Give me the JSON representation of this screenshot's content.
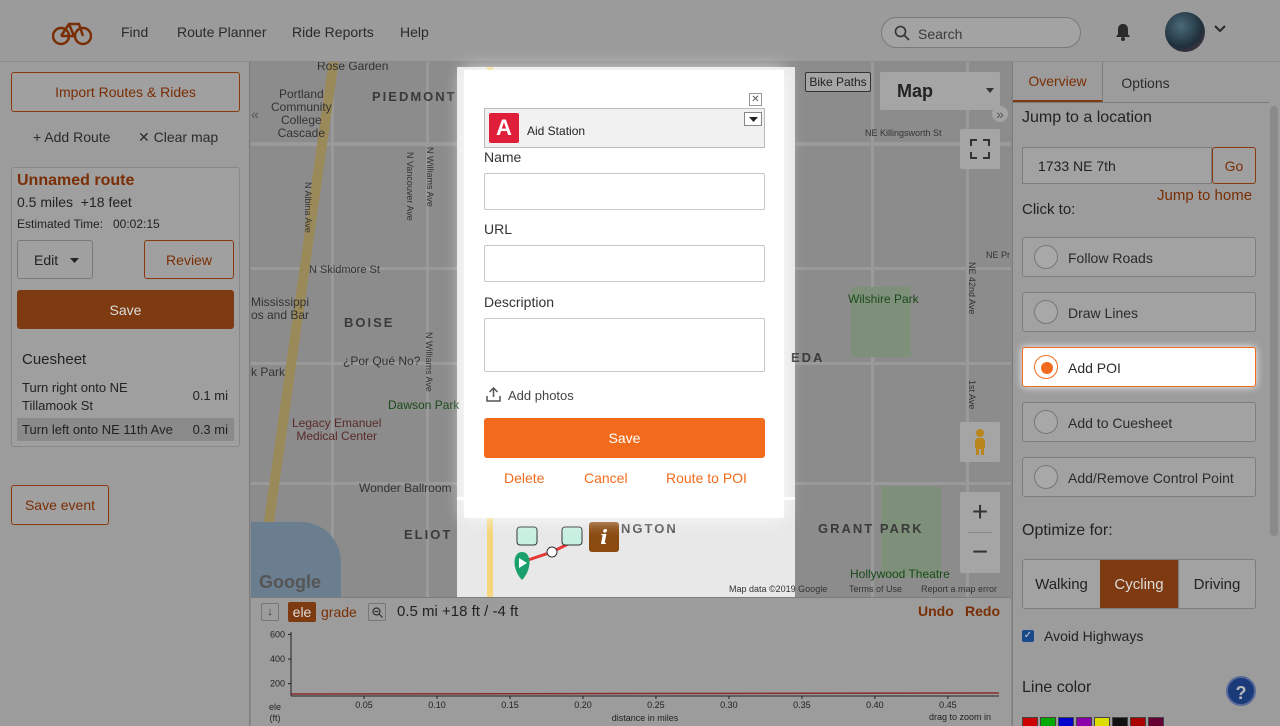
{
  "nav": {
    "find": "Find",
    "route_planner": "Route Planner",
    "ride_reports": "Ride Reports",
    "help": "Help",
    "search_placeholder": "Search"
  },
  "left": {
    "import_label": "Import Routes & Rides",
    "add_route": "+ Add Route",
    "clear_map": "✕ Clear map",
    "route_title": "Unnamed route",
    "route_stats": "0.5 miles  +18 feet",
    "estimated_label": "Estimated Time:",
    "estimated_value": "00:02:15",
    "edit_label": "Edit",
    "review_label": "Review",
    "save_label": "Save",
    "cuesheet_title": "Cuesheet",
    "cues": [
      {
        "text": "Turn right onto NE Tillamook St",
        "dist": "0.1 mi"
      },
      {
        "text": "Turn left onto NE 11th Ave",
        "dist": "0.3 mi"
      }
    ],
    "save_event": "Save event"
  },
  "map": {
    "bike_paths": "Bike Paths",
    "map_type": "Map",
    "labels": {
      "rose_garden": "Rose Garden",
      "pcc": "Portland\nCommunity\nCollege\nCascade",
      "piedmont": "PIEDMONT",
      "boise": "BOISE",
      "eliot": "ELIOT",
      "irvington": "NGTON",
      "grant_park": "GRANT PARK",
      "skidmore": "N Skidmore St",
      "mississippi": "Mississippi\nos and Bar",
      "por_que_no": "¿Por Qué No?",
      "dawson": "Dawson Park",
      "legacy": "Legacy Emanuel\nMedical Center",
      "wonder": "Wonder Ballroom",
      "wilshire": "Wilshire Park",
      "hollywood": "Hollywood Theatre",
      "killingsworth": "NE Killingsworth St",
      "k_park": "k Park",
      "eda": "EDA",
      "ne_pr": "NE Pr",
      "ne_42nd": "NE 42nd Ave",
      "n_albina": "N Albina Ave",
      "n_vancouver": "N Vancouver Ave",
      "n_williams": "N Williams Ave",
      "n_williams2": "N Williams Ave",
      "st_1": "1st Ave",
      "google": "Google",
      "map_data": "Map data ©2019 Google",
      "terms": "Terms of Use",
      "report": "Report a map error"
    }
  },
  "modal": {
    "poi_type": "Aid Station",
    "poi_letter": "A",
    "name_label": "Name",
    "url_label": "URL",
    "description_label": "Description",
    "add_photos": "Add photos",
    "save_label": "Save",
    "delete_label": "Delete",
    "cancel_label": "Cancel",
    "route_to_poi": "Route to POI"
  },
  "elevation": {
    "ele_tab": "ele",
    "grade_tab": "grade",
    "summary": "0.5 mi +18 ft / -4 ft",
    "undo": "Undo",
    "redo": "Redo",
    "y_ticks": [
      "600",
      "400",
      "200"
    ],
    "x_ticks": [
      "0.05",
      "0.10",
      "0.15",
      "0.20",
      "0.25",
      "0.30",
      "0.35",
      "0.40",
      "0.45"
    ],
    "ylabel": "ele\n(ft)",
    "xlabel": "distance in miles",
    "hint": "drag to zoom in"
  },
  "right": {
    "tab_overview": "Overview",
    "tab_options": "Options",
    "jump_title": "Jump to a location",
    "jump_value": "1733 NE 7th",
    "go_label": "Go",
    "jump_home": "Jump to home",
    "click_to": "Click to:",
    "options": [
      "Follow Roads",
      "Draw Lines",
      "Add POI",
      "Add to Cuesheet",
      "Add/Remove Control Point"
    ],
    "optimize": "Optimize for:",
    "modes": [
      "Walking",
      "Cycling",
      "Driving"
    ],
    "avoid_highways": "Avoid Highways",
    "line_color": "Line color"
  },
  "colors": {
    "accent": "#f26b1d",
    "accent_dim": "#7a2e05",
    "swatches": [
      "#cc0000",
      "#00aa00",
      "#0000cc",
      "#8a00aa",
      "#dddd00",
      "#111111",
      "#aa0000",
      "#660033"
    ]
  }
}
